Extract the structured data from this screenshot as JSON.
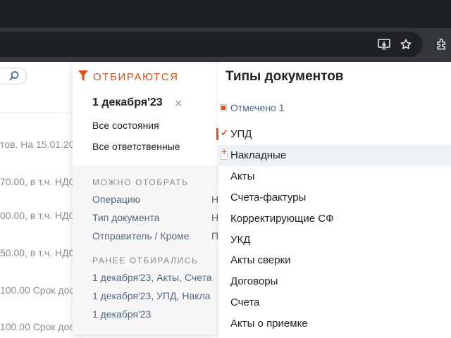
{
  "browser": {
    "icons": [
      "install-app-icon",
      "star-icon",
      "extensions-icon"
    ]
  },
  "background_rows": [
    "тов. На 15.01.20",
    "70.00, в т.ч. НДС",
    "00.00, в т.ч. НДС",
    "50.00, в т.ч. НДС",
    "100.00 Срок дос",
    "100.00 Срок дос"
  ],
  "filter": {
    "title": "ОТБИРАЮТСЯ",
    "selected_date": "1 декабря'23",
    "selected_items": [
      "Все состояния",
      "Все ответственные"
    ],
    "can_filter_heading": "МОЖНО ОТОБРАТЬ",
    "can_filter": [
      "Операцию",
      "Тип документа",
      "Отправитель / Кроме"
    ],
    "can_filter_right": [
      "Н",
      "Н",
      "П"
    ],
    "history_heading": "РАНЕЕ ОТБИРАЛИСЬ",
    "history": [
      "1 декабря'23, Акты, Счета",
      "1 декабря'23, УПД, Накла",
      "1 декабря'23"
    ],
    "accent_color": "#d9531e"
  },
  "doc_types": {
    "title": "Типы документов",
    "marked_label": "Отмечено 1",
    "items": [
      {
        "label": "УПД",
        "checked": true
      },
      {
        "label": "Накладные",
        "hover": true
      },
      {
        "label": "Акты"
      },
      {
        "label": "Счета-фактуры"
      },
      {
        "label": "Корректирующие СФ"
      },
      {
        "label": "УКД"
      },
      {
        "label": "Акты сверки"
      },
      {
        "label": "Договоры"
      },
      {
        "label": "Счета"
      },
      {
        "label": "Акты о приемке"
      }
    ]
  }
}
